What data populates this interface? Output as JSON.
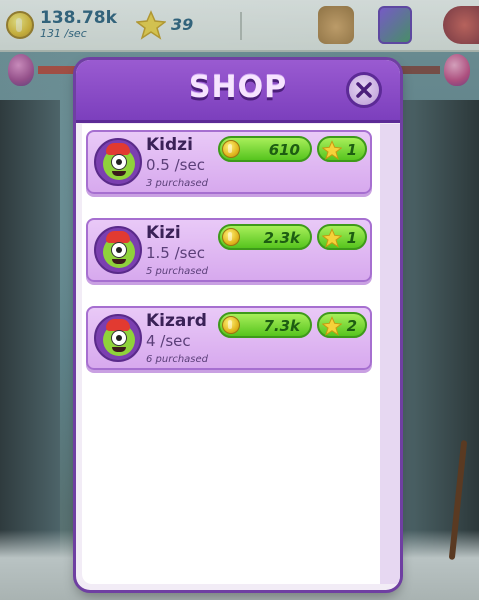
{
  "hud": {
    "coins_value": "138.78k",
    "coins_rate": "131 /sec",
    "stars_value": "39"
  },
  "shop": {
    "title": "SHOP",
    "items": [
      {
        "name": "Kidzi",
        "rate": "0.5 /sec",
        "purchased": "3 purchased",
        "coin_price": "610",
        "star_price": "1"
      },
      {
        "name": "Kizi",
        "rate": "1.5 /sec",
        "purchased": "5 purchased",
        "coin_price": "2.3k",
        "star_price": "1"
      },
      {
        "name": "Kizard",
        "rate": "4 /sec",
        "purchased": "6 purchased",
        "coin_price": "7.3k",
        "star_price": "2"
      }
    ]
  },
  "colors": {
    "header_purple": "#7c3fbd",
    "buy_green": "#56c41e",
    "coin_gold": "#e2b820"
  },
  "icons": [
    "coin-icon",
    "star-icon",
    "money-bag-icon",
    "book-icon",
    "egg-icon",
    "close-icon"
  ]
}
